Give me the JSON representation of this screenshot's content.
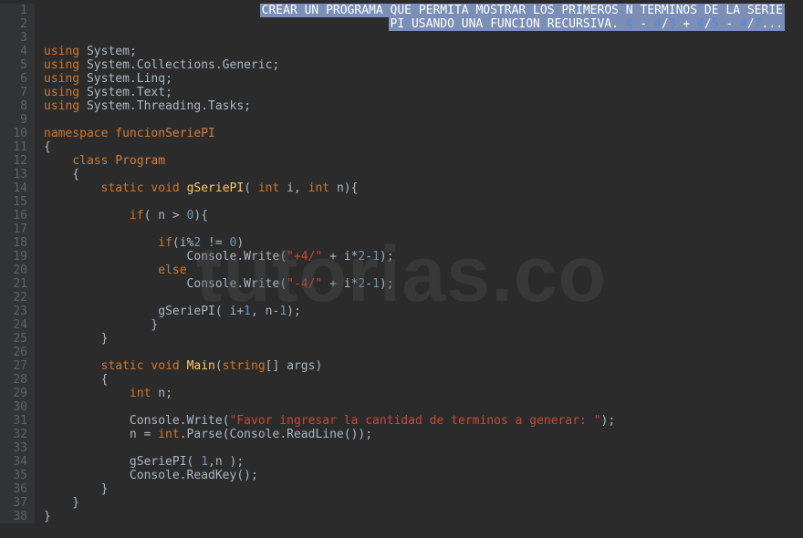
{
  "watermark": "tutorias.co",
  "comment": {
    "line1_pre": "CREAR UN PROGRAMA QUE PERMITA MOSTRAR LOS PRIMEROS N TERMINOS DE LA SERIE",
    "line2_pre": "PI USANDO UNA FUNCION RECURSIVA. ",
    "f1": "4",
    "d1": " - ",
    "f2": "4",
    "s2": "/",
    "f2b": "3",
    "d2": " + ",
    "f3": "4",
    "s3": "/",
    "f3b": "5",
    "d3": " - ",
    "f4": "4",
    "s4": "/",
    "f4b": "7",
    "tail": "..."
  },
  "code": {
    "using": "using",
    "sys": "System",
    "sys_coll": "System.Collections.Generic",
    "sys_linq": "System.Linq",
    "sys_text": "System.Text",
    "sys_tasks": "System.Threading.Tasks",
    "namespace": "namespace",
    "ns_name": "funcionSeriePI",
    "class": "class",
    "class_name": "Program",
    "static": "static",
    "void": "void",
    "gSeriePI": "gSeriePI",
    "int": "int",
    "i": "i",
    "n": "n",
    "if": "if",
    "gt": ">",
    "zero": "0",
    "mod": "%",
    "two": "2",
    "neq": "!=",
    "console": "Console",
    "write": "Write",
    "plus4": "\"+4/\"",
    "plus": "+",
    "star": "*",
    "minus": "-",
    "one": "1",
    "else": "else",
    "minus4": "\"-4/\"",
    "Main": "Main",
    "string_arr": "string",
    "args": "args",
    "prompt": "\"Favor ingresar la cantidad de terminos a generar: \"",
    "parse": "Parse",
    "readline": "ReadLine",
    "readkey": "ReadKey",
    "eq": "="
  },
  "lines": [
    1,
    2,
    3,
    4,
    5,
    6,
    7,
    8,
    9,
    10,
    11,
    12,
    13,
    14,
    15,
    16,
    17,
    18,
    19,
    20,
    21,
    22,
    23,
    24,
    25,
    26,
    27,
    28,
    29,
    30,
    31,
    32,
    33,
    34,
    35,
    36,
    37,
    38
  ]
}
